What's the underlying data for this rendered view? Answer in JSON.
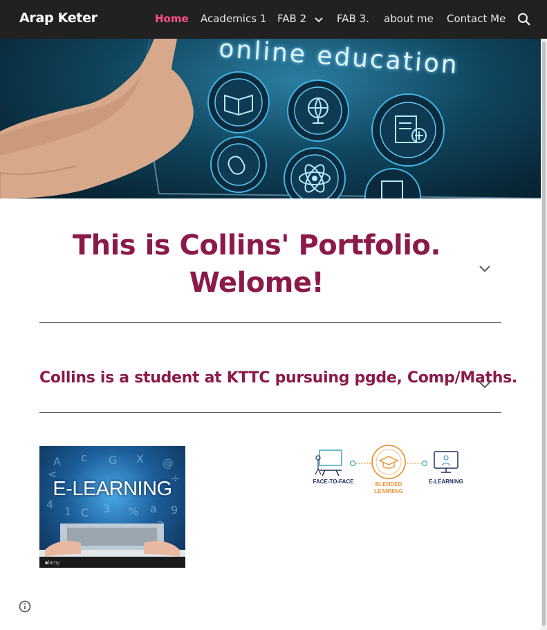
{
  "site": {
    "title": "Arap Keter"
  },
  "nav": {
    "items": [
      {
        "label": "Home",
        "active": true
      },
      {
        "label": "Academics 1",
        "active": false
      },
      {
        "label": "FAB 2",
        "active": false,
        "has_dropdown": true
      },
      {
        "label": "FAB 3.",
        "active": false
      },
      {
        "label": "about me",
        "active": false
      },
      {
        "label": "Contact Me",
        "active": false
      }
    ],
    "search_icon": "search-icon",
    "dropdown_icon": "chevron-down-icon"
  },
  "hero": {
    "text": "online education",
    "icons": [
      "book-icon",
      "globe-icon",
      "clipboard-icon",
      "mouse-icon",
      "atom-icon",
      "document-icon"
    ]
  },
  "main": {
    "heading_line1": "This is Collins' Portfolio.",
    "heading_line2": "Welome!",
    "subheading": "Collins is a student at KTTC pursuing pgde, Comp/Maths.",
    "expand_icon": "chevron-down-icon"
  },
  "images": {
    "elearning": {
      "title": "E-LEARNING",
      "watermark": "alamy"
    },
    "blended": {
      "left_caption": "FACE-TO-FACE",
      "center_caption_line1": "BLENDED",
      "center_caption_line2": "LEARNING",
      "right_caption": "E-LEARNING"
    }
  },
  "footer": {
    "info_icon": "info-icon"
  },
  "colors": {
    "topbar": "#212121",
    "nav_active": "#ff4f8b",
    "heading": "#8b1a4a",
    "divider": "#616161",
    "blended_orange": "#e8963a",
    "blended_navy": "#1f2f5c",
    "blended_teal": "#3aa6b9"
  }
}
